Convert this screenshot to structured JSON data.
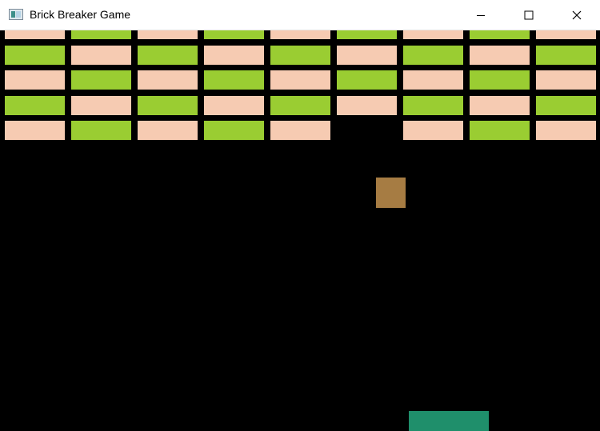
{
  "window": {
    "title": "Brick Breaker Game",
    "icon": "app-window-icon",
    "controls": [
      "minimize-icon",
      "maximize-icon",
      "close-icon"
    ]
  },
  "game": {
    "background_color": "#000000",
    "brick_colors": {
      "peach": "#f6cbb2",
      "green": "#9acd32"
    },
    "ball_color": "#a67c43",
    "paddle_color": "#1f8f6b",
    "bricks": [
      [
        {
          "row": 0,
          "col": 0,
          "color": "peach"
        },
        {
          "row": 0,
          "col": 1,
          "color": "green"
        },
        {
          "row": 0,
          "col": 2,
          "color": "peach"
        },
        {
          "row": 0,
          "col": 3,
          "color": "green"
        },
        {
          "row": 0,
          "col": 4,
          "color": "peach"
        },
        {
          "row": 0,
          "col": 5,
          "color": "green"
        },
        {
          "row": 0,
          "col": 6,
          "color": "peach"
        },
        {
          "row": 0,
          "col": 7,
          "color": "green"
        },
        {
          "row": 0,
          "col": 8,
          "color": "peach"
        }
      ],
      [
        {
          "row": 1,
          "col": 0,
          "color": "green"
        },
        {
          "row": 1,
          "col": 1,
          "color": "peach"
        },
        {
          "row": 1,
          "col": 2,
          "color": "green"
        },
        {
          "row": 1,
          "col": 3,
          "color": "peach"
        },
        {
          "row": 1,
          "col": 4,
          "color": "green"
        },
        {
          "row": 1,
          "col": 5,
          "color": "peach"
        },
        {
          "row": 1,
          "col": 6,
          "color": "green"
        },
        {
          "row": 1,
          "col": 7,
          "color": "peach"
        },
        {
          "row": 1,
          "col": 8,
          "color": "green"
        }
      ],
      [
        {
          "row": 2,
          "col": 0,
          "color": "peach"
        },
        {
          "row": 2,
          "col": 1,
          "color": "green"
        },
        {
          "row": 2,
          "col": 2,
          "color": "peach"
        },
        {
          "row": 2,
          "col": 3,
          "color": "green"
        },
        {
          "row": 2,
          "col": 4,
          "color": "peach"
        },
        {
          "row": 2,
          "col": 5,
          "color": "green"
        },
        {
          "row": 2,
          "col": 6,
          "color": "peach"
        },
        {
          "row": 2,
          "col": 7,
          "color": "green"
        },
        {
          "row": 2,
          "col": 8,
          "color": "peach"
        }
      ],
      [
        {
          "row": 3,
          "col": 0,
          "color": "green"
        },
        {
          "row": 3,
          "col": 1,
          "color": "peach"
        },
        {
          "row": 3,
          "col": 2,
          "color": "green"
        },
        {
          "row": 3,
          "col": 3,
          "color": "peach"
        },
        {
          "row": 3,
          "col": 4,
          "color": "green"
        },
        {
          "row": 3,
          "col": 5,
          "color": "peach"
        },
        {
          "row": 3,
          "col": 6,
          "color": "green"
        },
        {
          "row": 3,
          "col": 7,
          "color": "peach"
        },
        {
          "row": 3,
          "col": 8,
          "color": "green"
        }
      ],
      [
        {
          "row": 4,
          "col": 0,
          "color": "peach"
        },
        {
          "row": 4,
          "col": 1,
          "color": "green"
        },
        {
          "row": 4,
          "col": 2,
          "color": "peach"
        },
        {
          "row": 4,
          "col": 3,
          "color": "green"
        },
        {
          "row": 4,
          "col": 4,
          "color": "peach"
        },
        {
          "row": 4,
          "col": 6,
          "color": "peach"
        },
        {
          "row": 4,
          "col": 7,
          "color": "green"
        },
        {
          "row": 4,
          "col": 8,
          "color": "peach"
        }
      ]
    ]
  }
}
